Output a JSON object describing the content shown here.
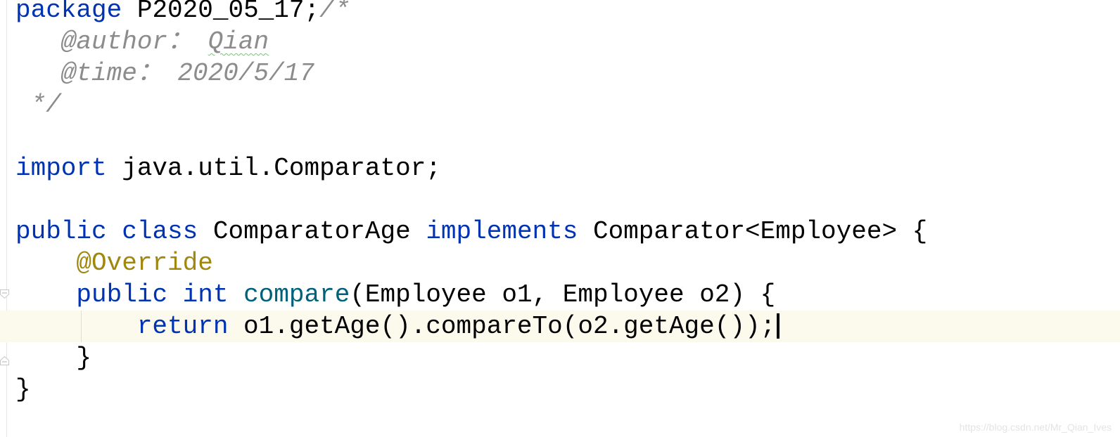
{
  "editor": {
    "current_line": 10,
    "lines": [
      [
        {
          "t": "package",
          "c": "kw"
        },
        {
          "t": " P2020_05_17;",
          "c": "pl"
        },
        {
          "t": "/*",
          "c": "cm"
        }
      ],
      [
        {
          "t": "   @author",
          "c": "cm"
        },
        {
          "t": "： ",
          "c": "cm"
        },
        {
          "t": "Qian",
          "c": "cm typo"
        }
      ],
      [
        {
          "t": "   @time",
          "c": "cm"
        },
        {
          "t": "： 2020/5/17",
          "c": "cm"
        }
      ],
      [
        {
          "t": " */",
          "c": "cm"
        }
      ],
      [],
      [
        {
          "t": "import",
          "c": "kw"
        },
        {
          "t": " java.util.Comparator;",
          "c": "pl"
        }
      ],
      [],
      [
        {
          "t": "public",
          "c": "kw"
        },
        {
          "t": " ",
          "c": "pl"
        },
        {
          "t": "class",
          "c": "kw"
        },
        {
          "t": " ComparatorAge ",
          "c": "pl"
        },
        {
          "t": "implements",
          "c": "kw"
        },
        {
          "t": " Comparator<Employee> {",
          "c": "pl"
        }
      ],
      [
        {
          "t": "    ",
          "c": "pl"
        },
        {
          "t": "@Override",
          "c": "an"
        }
      ],
      [
        {
          "t": "    ",
          "c": "pl"
        },
        {
          "t": "public",
          "c": "kw"
        },
        {
          "t": " ",
          "c": "pl"
        },
        {
          "t": "int",
          "c": "kw"
        },
        {
          "t": " ",
          "c": "pl"
        },
        {
          "t": "compare",
          "c": "fn"
        },
        {
          "t": "(Employee o1, Employee o2) {",
          "c": "pl"
        }
      ],
      [
        {
          "t": "        ",
          "c": "pl"
        },
        {
          "t": "return",
          "c": "kw"
        },
        {
          "t": " o1.getAge().compareTo(o2.getAge());",
          "c": "pl"
        }
      ],
      [
        {
          "t": "    }",
          "c": "pl"
        }
      ],
      [
        {
          "t": "}",
          "c": "pl"
        }
      ]
    ]
  },
  "watermark": "https://blog.csdn.net/Mr_Qian_Ives"
}
